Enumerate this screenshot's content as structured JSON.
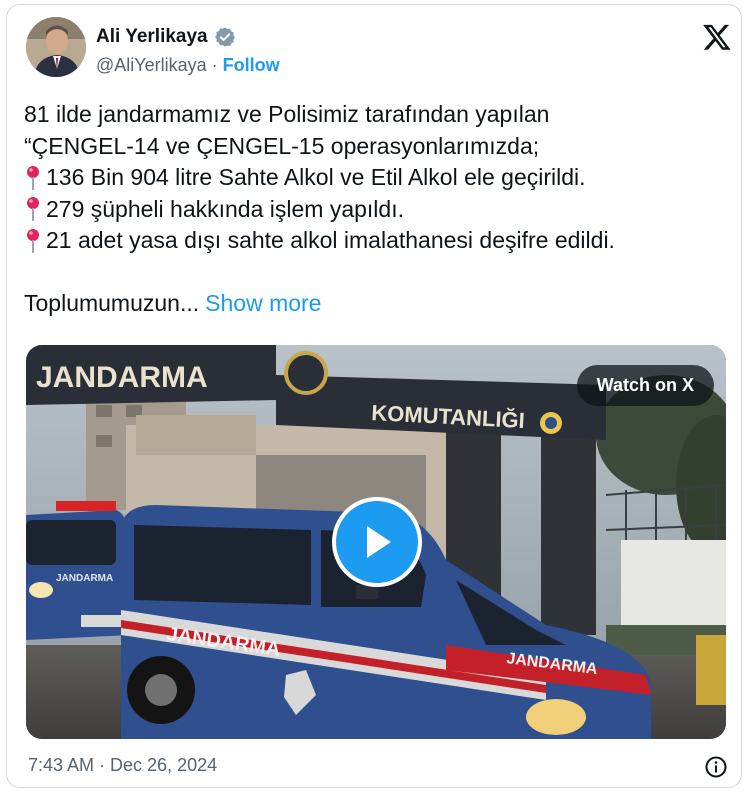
{
  "author": {
    "name": "Ali Yerlikaya",
    "handle": "@AliYerlikaya",
    "separator": "·",
    "follow_label": "Follow"
  },
  "tweet": {
    "lines": [
      "81 ilde jandarmamız ve Polisimiz tarafından yapılan",
      "“ÇENGEL-14 ve ÇENGEL-15 operasyonlarımızda;",
      "136 Bin 904 litre Sahte Alkol ve Etil Alkol ele geçirildi.",
      "279 şüpheli hakkında işlem yapıldı.",
      "21 adet yasa dışı sahte alkol imalathanesi deşifre edildi."
    ],
    "truncated": "Toplumumuzun...",
    "show_more": "Show more"
  },
  "media": {
    "watch_label": "Watch on X",
    "sign_left": "JANDARMA",
    "sign_right": "KOMUTANLIĞI",
    "van_left_text": "JANDARMA",
    "van_front_text": "JANDARMA",
    "small_van_text": "JANDARMA"
  },
  "footer": {
    "timestamp": "7:43 AM · Dec 26, 2024"
  },
  "colors": {
    "accent": "#1d9bf0",
    "text": "#0f1419",
    "muted": "#536471",
    "border": "#cfd9de"
  },
  "icons": [
    "verified-badge-icon",
    "x-logo-icon",
    "pushpin-icon",
    "play-icon",
    "info-icon"
  ]
}
